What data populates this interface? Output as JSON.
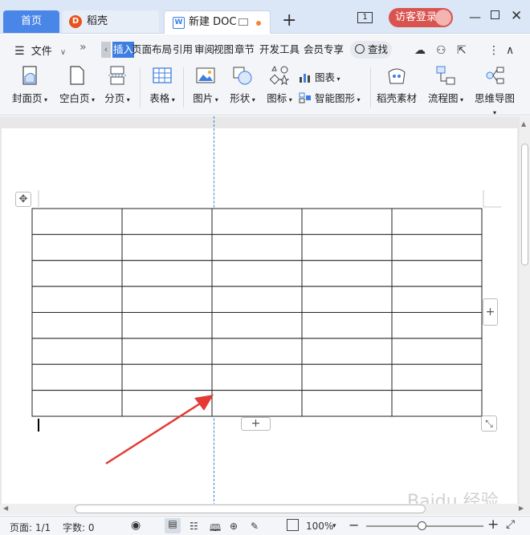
{
  "tabs": {
    "home": "首页",
    "daoke": "稻壳",
    "doc": "新建 DOC"
  },
  "titlebar": {
    "page_count_icon": "1",
    "login_label": "访客登录"
  },
  "menu": {
    "file_label": "文件",
    "items": [
      "插入",
      "页面布局",
      "引用",
      "审阅",
      "视图",
      "章节",
      "开发工具",
      "会员专享"
    ],
    "active_item": "插入",
    "search_label": "查找"
  },
  "toolbar": {
    "cover_page": "封面页",
    "blank_page": "空白页",
    "page_break": "分页",
    "table": "表格",
    "picture": "图片",
    "shapes": "形状",
    "icons": "图标",
    "chart": "图表",
    "smart_art": "智能图形",
    "daoke_material": "稻壳素材",
    "flowchart": "流程图",
    "mindmap": "思维导图"
  },
  "table": {
    "rows": 8,
    "cols": 5,
    "add_column_symbol": "+",
    "add_row_symbol": "+",
    "move_handle_symbol": "✥"
  },
  "statusbar": {
    "page_info": "页面: 1/1",
    "word_count": "字数: 0",
    "zoom": "100%"
  },
  "colors": {
    "accent": "#3d7ee0",
    "login_red": "#d9534f",
    "arrow_red": "#e53935"
  },
  "watermark": "Baidu 经验"
}
